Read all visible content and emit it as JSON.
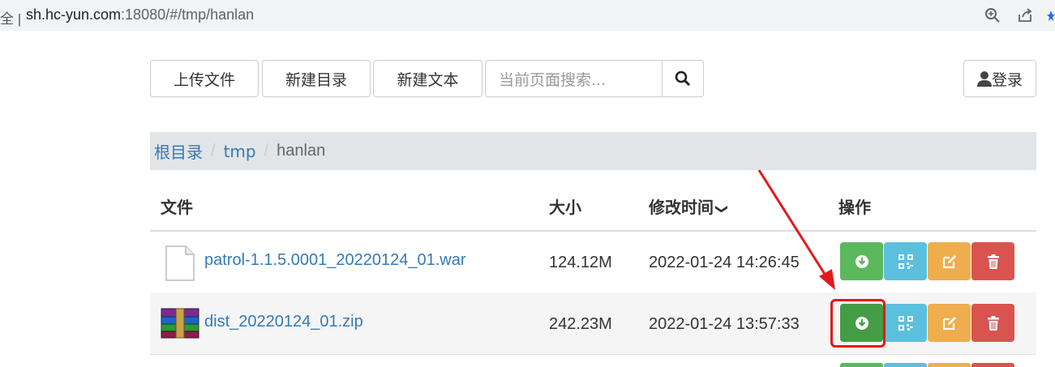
{
  "browser": {
    "left_fragment": "全 |",
    "url_host": "sh.hc-yun.com",
    "url_rest": ":18080/#/tmp/hanlan",
    "icons": [
      "zoom-icon",
      "share-icon",
      "star-icon"
    ]
  },
  "toolbar": {
    "upload_label": "上传文件",
    "new_dir_label": "新建目录",
    "new_text_label": "新建文本",
    "search_placeholder": "当前页面搜索...",
    "login_label": "登录"
  },
  "breadcrumb": {
    "items": [
      "根目录",
      "tmp"
    ],
    "current": "hanlan",
    "separator": "/"
  },
  "table": {
    "headers": {
      "file": "文件",
      "size": "大小",
      "modified": "修改时间",
      "modified_sort": "❯",
      "actions": "操作"
    },
    "rows": [
      {
        "name": "patrol-1.1.5.0001_20220124_01.war",
        "size": "124.12M",
        "modified": "2022-01-24 14:26:45",
        "icon": "file-icon"
      },
      {
        "name": "dist_20220124_01.zip",
        "size": "242.23M",
        "modified": "2022-01-24 13:57:33",
        "icon": "winrar-archive-icon"
      }
    ]
  },
  "colors": {
    "download": "#5cb85c",
    "qrcode": "#5bc0de",
    "edit": "#f0ad4e",
    "delete": "#d9534f",
    "link": "#337ab7",
    "annotation": "#e21a1a"
  }
}
